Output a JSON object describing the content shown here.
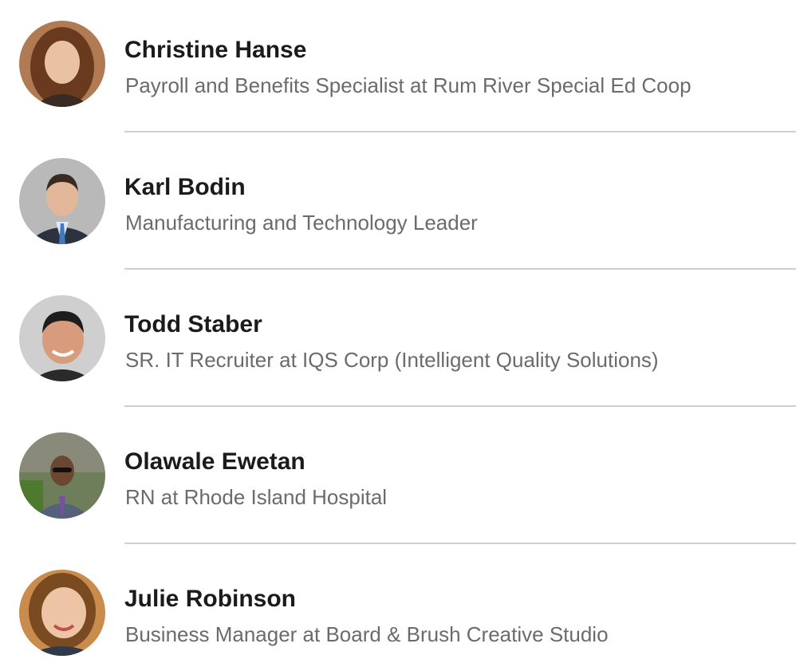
{
  "people": [
    {
      "name": "Christine Hanse",
      "headline": "Payroll and Benefits Specialist at Rum River Special Ed Coop",
      "avatar_icon": "person-photo-christine",
      "avatar_colors": {
        "bg": "#b07a52",
        "hair": "#6a3a1e",
        "skin": "#e9c2a4",
        "shirt": "#3a2a24"
      }
    },
    {
      "name": "Karl Bodin",
      "headline": "Manufacturing and Technology Leader",
      "avatar_icon": "person-photo-karl",
      "avatar_colors": {
        "bg": "#b9b9b9",
        "hair": "#3a2a20",
        "skin": "#e2b79a",
        "shirt": "#2d3240"
      }
    },
    {
      "name": "Todd Staber",
      "headline": "SR. IT Recruiter at IQS Corp (Intelligent Quality Solutions)",
      "avatar_icon": "person-photo-todd",
      "avatar_colors": {
        "bg": "#cfcfcf",
        "hair": "#1d1d1d",
        "skin": "#d69c7c",
        "shirt": "#2a2a2a"
      }
    },
    {
      "name": "Olawale Ewetan",
      "headline": "RN at Rhode Island Hospital",
      "avatar_icon": "person-photo-olawale",
      "avatar_colors": {
        "bg": "#6f7e5a",
        "hair": "#1f1f1f",
        "skin": "#6b4630",
        "shirt": "#55607a"
      }
    },
    {
      "name": "Julie Robinson",
      "headline": "Business Manager at Board & Brush Creative Studio",
      "avatar_icon": "person-photo-julie",
      "avatar_colors": {
        "bg": "#c98c4c",
        "hair": "#7a4a20",
        "skin": "#eec4a6",
        "shirt": "#2f3a4a"
      }
    }
  ]
}
